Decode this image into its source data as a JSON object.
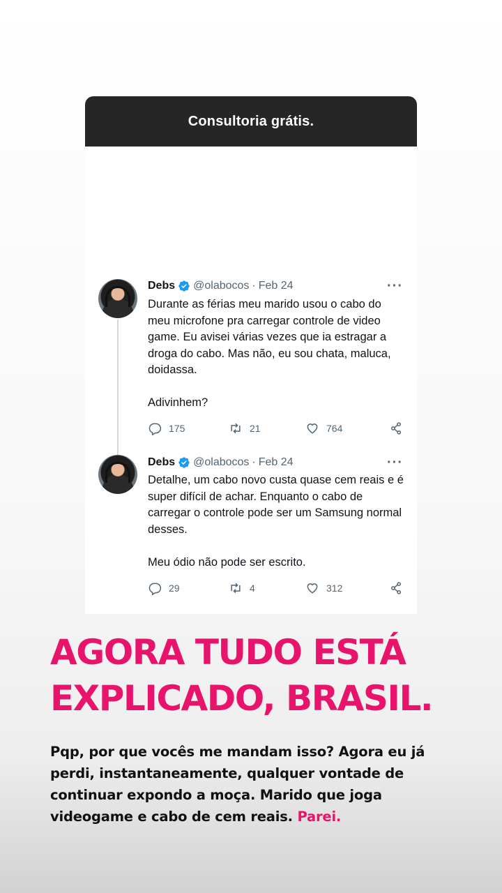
{
  "card": {
    "header_title": "Consultoria grátis."
  },
  "tweets": [
    {
      "name": "Debs",
      "handle": "@olabocos",
      "separator": "·",
      "date": "Feb 24",
      "more": "···",
      "paragraphs": [
        "Durante as férias meu marido usou o cabo do meu microfone pra carregar controle de video game. Eu avisei várias vezes que ia estragar a droga do cabo. Mas não, eu sou chata, maluca, doidassa.",
        "Adivinhem?"
      ],
      "replies": "175",
      "retweets": "21",
      "likes": "764"
    },
    {
      "name": "Debs",
      "handle": "@olabocos",
      "separator": "·",
      "date": "Feb 24",
      "more": "···",
      "paragraphs": [
        "Detalhe, um cabo novo custa quase cem reais e é super difícil de achar. Enquanto o cabo de carregar o controle pode ser um Samsung normal desses.",
        "Meu ódio não pode ser escrito."
      ],
      "replies": "29",
      "retweets": "4",
      "likes": "312"
    }
  ],
  "headline": {
    "line1": "AGORA TUDO ESTÁ",
    "line2": "EXPLICADO, BRASIL."
  },
  "caption": {
    "text": "Pqp, por que vocês me mandam isso? Agora eu já perdi, instantaneamente, qualquer vontade de continuar expondo a moça. Marido que joga videogame e cabo de cem reais.",
    "accent": "Parei."
  },
  "colors": {
    "accent": "#e8146c",
    "header_bg": "#262626",
    "verified": "#1d9bf0",
    "muted": "#536471"
  },
  "icons": [
    "reply-icon",
    "retweet-icon",
    "like-icon",
    "share-icon",
    "verified-badge-icon",
    "more-options-icon"
  ]
}
